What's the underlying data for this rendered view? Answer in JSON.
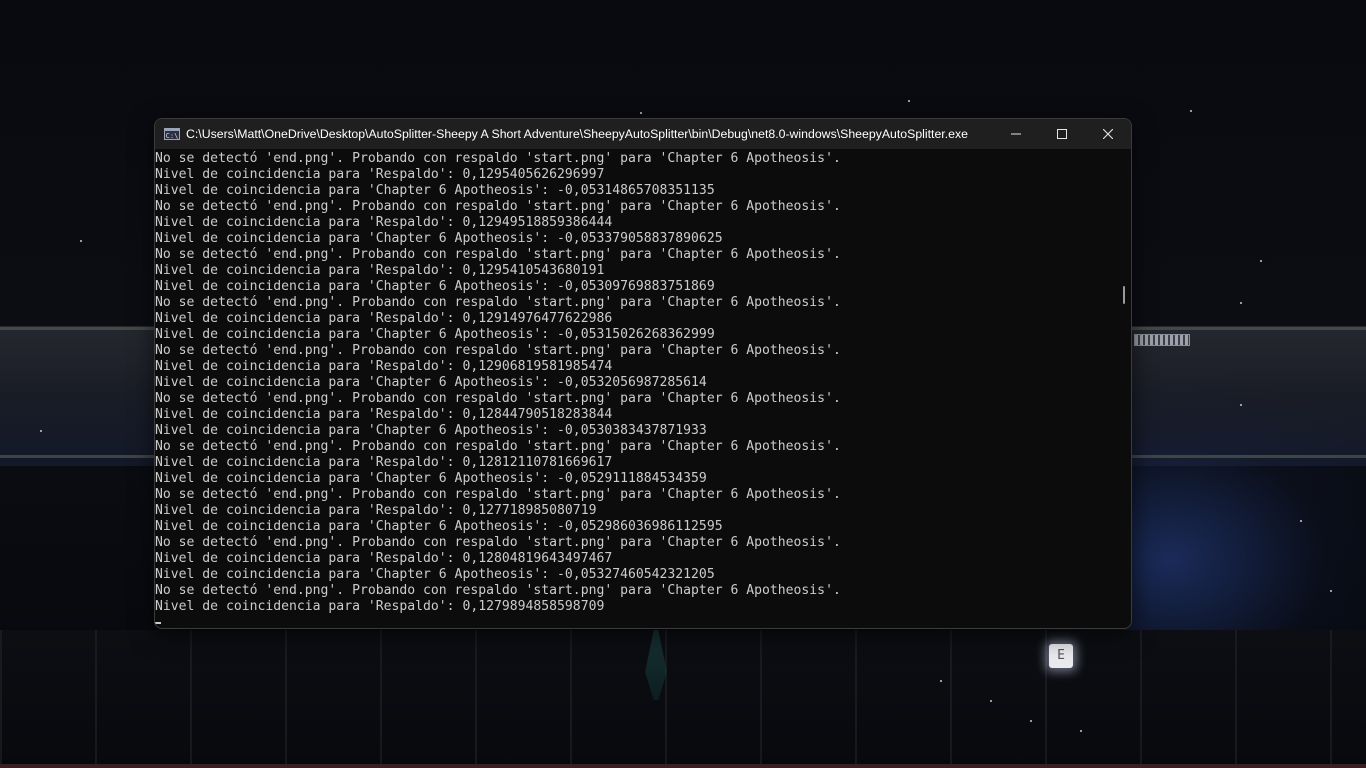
{
  "window": {
    "title": "C:\\Users\\Matt\\OneDrive\\Desktop\\AutoSplitter-Sheepy A Short Adventure\\SheepyAutoSplitter\\bin\\Debug\\net8.0-windows\\SheepyAutoSplitter.exe",
    "app_icon": "console-icon",
    "app_icon_text": "C:\\",
    "controls": [
      "minimize-icon",
      "maximize-icon",
      "close-icon"
    ]
  },
  "console": {
    "lines": [
      "No se detectó 'end.png'. Probando con respaldo 'start.png' para 'Chapter 6 Apotheosis'.",
      "Nivel de coincidencia para 'Respaldo': 0,1295405626296997",
      "Nivel de coincidencia para 'Chapter 6 Apotheosis': -0,05314865708351135",
      "No se detectó 'end.png'. Probando con respaldo 'start.png' para 'Chapter 6 Apotheosis'.",
      "Nivel de coincidencia para 'Respaldo': 0,12949518859386444",
      "Nivel de coincidencia para 'Chapter 6 Apotheosis': -0,053379058837890625",
      "No se detectó 'end.png'. Probando con respaldo 'start.png' para 'Chapter 6 Apotheosis'.",
      "Nivel de coincidencia para 'Respaldo': 0,1295410543680191",
      "Nivel de coincidencia para 'Chapter 6 Apotheosis': -0,05309769883751869",
      "No se detectó 'end.png'. Probando con respaldo 'start.png' para 'Chapter 6 Apotheosis'.",
      "Nivel de coincidencia para 'Respaldo': 0,12914976477622986",
      "Nivel de coincidencia para 'Chapter 6 Apotheosis': -0,05315026268362999",
      "No se detectó 'end.png'. Probando con respaldo 'start.png' para 'Chapter 6 Apotheosis'.",
      "Nivel de coincidencia para 'Respaldo': 0,12906819581985474",
      "Nivel de coincidencia para 'Chapter 6 Apotheosis': -0,0532056987285614",
      "No se detectó 'end.png'. Probando con respaldo 'start.png' para 'Chapter 6 Apotheosis'.",
      "Nivel de coincidencia para 'Respaldo': 0,12844790518283844",
      "Nivel de coincidencia para 'Chapter 6 Apotheosis': -0,0530383437871933",
      "No se detectó 'end.png'. Probando con respaldo 'start.png' para 'Chapter 6 Apotheosis'.",
      "Nivel de coincidencia para 'Respaldo': 0,12812110781669617",
      "Nivel de coincidencia para 'Chapter 6 Apotheosis': -0,0529111884534359",
      "No se detectó 'end.png'. Probando con respaldo 'start.png' para 'Chapter 6 Apotheosis'.",
      "Nivel de coincidencia para 'Respaldo': 0,127718985080719",
      "Nivel de coincidencia para 'Chapter 6 Apotheosis': -0,052986036986112595",
      "No se detectó 'end.png'. Probando con respaldo 'start.png' para 'Chapter 6 Apotheosis'.",
      "Nivel de coincidencia para 'Respaldo': 0,12804819643497467",
      "Nivel de coincidencia para 'Chapter 6 Apotheosis': -0,05327460542321205",
      "No se detectó 'end.png'. Probando con respaldo 'start.png' para 'Chapter 6 Apotheosis'.",
      "Nivel de coincidencia para 'Respaldo': 0,1279894858598709"
    ]
  },
  "background": {
    "sign_letter": "E"
  },
  "colors": {
    "console_bg": "#0c0c0c",
    "console_text": "#cccccc",
    "titlebar_bg": "#1f1f1f",
    "title_text": "#ffffff"
  }
}
